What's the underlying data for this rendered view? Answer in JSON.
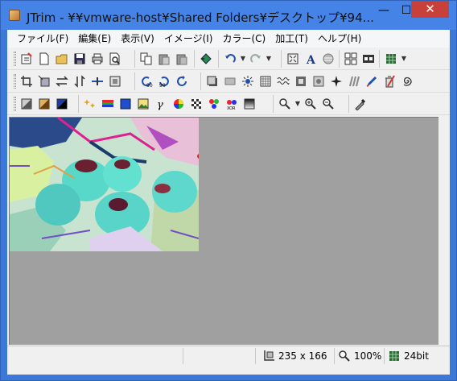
{
  "window": {
    "title": "JTrim - ¥¥vmware-host¥Shared Folders¥デスクトップ¥94...",
    "minimize_glyph": "—",
    "maximize_glyph": "☐",
    "close_glyph": "✕"
  },
  "menubar": {
    "items": [
      "ファイル(F)",
      "編集(E)",
      "表示(V)",
      "イメージ(I)",
      "カラー(C)",
      "加工(T)",
      "ヘルプ(H)"
    ]
  },
  "toolbars": {
    "row1": [
      "properties-icon",
      "new-file-icon",
      "open-folder-icon",
      "save-icon",
      "print-icon",
      "print-preview-icon",
      "copy-icon",
      "paste-icon",
      "paste-new-icon",
      "browse-icon",
      "undo-icon",
      "redo-icon",
      "fit-window-icon",
      "text-icon",
      "circle-icon",
      "grid-icon",
      "film-icon",
      "palette-icon"
    ],
    "row2": [
      "crop-icon",
      "resize-icon",
      "flip-horizontal-icon",
      "flip-vertical-icon",
      "shift-icon",
      "frame-icon",
      "rotate-left-90-icon",
      "rotate-right-90-icon",
      "rotate-icon",
      "shadow-icon",
      "bevel-icon",
      "sun-icon",
      "mosaic-icon",
      "wave-icon",
      "emboss-icon",
      "blur-icon",
      "sparkle-icon",
      "sharpen-icon",
      "pen-icon",
      "trash-icon",
      "swirl-icon"
    ],
    "row3": [
      "grayscale-icon",
      "sepia-icon",
      "negative-icon",
      "stars-icon",
      "rgb-bars-icon",
      "blue-square-icon",
      "picture-icon",
      "gamma-icon",
      "color-wheel-icon",
      "checker-icon",
      "rgb-dots-icon",
      "xor-icon",
      "gradient-icon",
      "zoom-dropdown-icon",
      "zoom-in-icon",
      "zoom-out-icon",
      "eyedropper-icon"
    ]
  },
  "statusbar": {
    "dimensions": "235 x 166",
    "zoom": "100%",
    "bit_depth": "24bit"
  },
  "colors": {
    "titlebar": "#4583e6",
    "close_button": "#c7403a",
    "canvas_bg": "#a0a0a0",
    "client_bg": "#f0f0f0"
  }
}
